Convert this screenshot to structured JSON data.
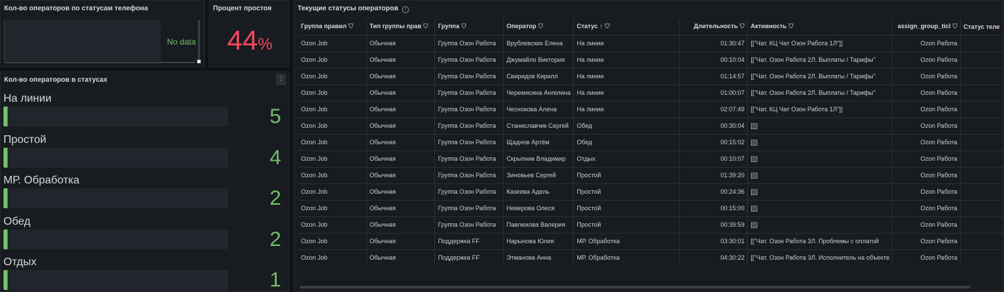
{
  "phone_status_panel": {
    "title": "Кол-во операторов по статусам телефона",
    "no_data": "No data"
  },
  "idle_panel": {
    "title": "Процент простоя",
    "value": "44",
    "unit": "%",
    "value_color": "#f2495c"
  },
  "status_count_panel": {
    "title": "Кол-во операторов в статусах",
    "accent_color": "#73bf69",
    "items": [
      {
        "label": "На линии",
        "value": "5"
      },
      {
        "label": "Простой",
        "value": "4"
      },
      {
        "label": "МР. Обработка",
        "value": "2"
      },
      {
        "label": "Обед",
        "value": "2"
      },
      {
        "label": "Отдых",
        "value": "1"
      }
    ]
  },
  "operators_panel": {
    "title": "Текущие статусы операторов",
    "columns": [
      "Группа правил",
      "Тип группы прав",
      "Группа",
      "Оператор",
      "Статус",
      "Длительность",
      "Активность",
      "assign_group_ticl",
      "Статус теле"
    ],
    "rows": [
      [
        "Ozon Job",
        "Обычная",
        "Группа Озон Работа",
        "Врублевских Елена",
        "На линии",
        "01:30:47",
        "[[\"Чат. КЦ Чат Озон Работа 1Л\"]]",
        "Ozon Работа",
        ""
      ],
      [
        "Ozon Job",
        "Обычная",
        "Группа Озон Работа",
        "Джумайло Виктория",
        "На линии",
        "00:10:04",
        "[[\"Чат. Озон Работа 2Л. Выплаты / Тарифы\"",
        "Ozon Работа",
        ""
      ],
      [
        "Ozon Job",
        "Обычная",
        "Группа Озон Работа",
        "Свиридов Кирилл",
        "На линии",
        "01:14:57",
        "[[\"Чат. Озон Работа 2Л. Выплаты / Тарифы\"",
        "Ozon Работа",
        ""
      ],
      [
        "Ozon Job",
        "Обычная",
        "Группа Озон Работа",
        "Черемисина Ангелина",
        "На линии",
        "01:00:07",
        "[[\"Чат. Озон Работа 2Л. Выплаты / Тарифы\"",
        "Ozon Работа",
        ""
      ],
      [
        "Ozon Job",
        "Обычная",
        "Группа Озон Работа",
        "Чеснокова Алена",
        "На линии",
        "02:07:49",
        "[[\"Чат. КЦ Чат Озон Работа 1Л\"]]",
        "Ozon Работа",
        ""
      ],
      [
        "Ozon Job",
        "Обычная",
        "Группа Озон Работа",
        "Станиславчик Сергей",
        "Обед",
        "00:30:04",
        "[[]]",
        "Ozon Работа",
        ""
      ],
      [
        "Ozon Job",
        "Обычная",
        "Группа Озон Работа",
        "Щаднов Артём",
        "Обед",
        "00:15:02",
        "[[]]",
        "Ozon Работа",
        ""
      ],
      [
        "Ozon Job",
        "Обычная",
        "Группа Озон Работа",
        "Скрыпник Владимир",
        "Отдых",
        "00:10:07",
        "[[]]",
        "Ozon Работа",
        ""
      ],
      [
        "Ozon Job",
        "Обычная",
        "Группа Озон Работа",
        "Зиновьев Сергей",
        "Простой",
        "01:39:20",
        "[[]]",
        "Ozon Работа",
        ""
      ],
      [
        "Ozon Job",
        "Обычная",
        "Группа Озон Работа",
        "Казеева Адель",
        "Простой",
        "00:24:36",
        "[[]]",
        "Ozon Работа",
        ""
      ],
      [
        "Ozon Job",
        "Обычная",
        "Группа Озон Работа",
        "Неверова Олеся",
        "Простой",
        "00:15:00",
        "[[]]",
        "Ozon Работа",
        ""
      ],
      [
        "Ozon Job",
        "Обычная",
        "Группа Озон Работа",
        "Павлюкова Валерия",
        "Простой",
        "00:39:59",
        "[[]]",
        "Ozon Работа",
        ""
      ],
      [
        "Ozon Job",
        "Обычная",
        "Поддержка FF",
        "Нарынова Юлия",
        "МР. Обработка",
        "03:30:01",
        "[[\"Чат. Озон Работа 3Л. Проблемы с оплатой",
        "Ozon Работа",
        ""
      ],
      [
        "Ozon Job",
        "Обычная",
        "Поддержка FF",
        "Этманова Анна",
        "МР. Обработка",
        "04:30:22",
        "[[\"Чат. Озон Работа 3Л. Исполнитель на объекте",
        "Ozon Работа",
        ""
      ]
    ]
  }
}
